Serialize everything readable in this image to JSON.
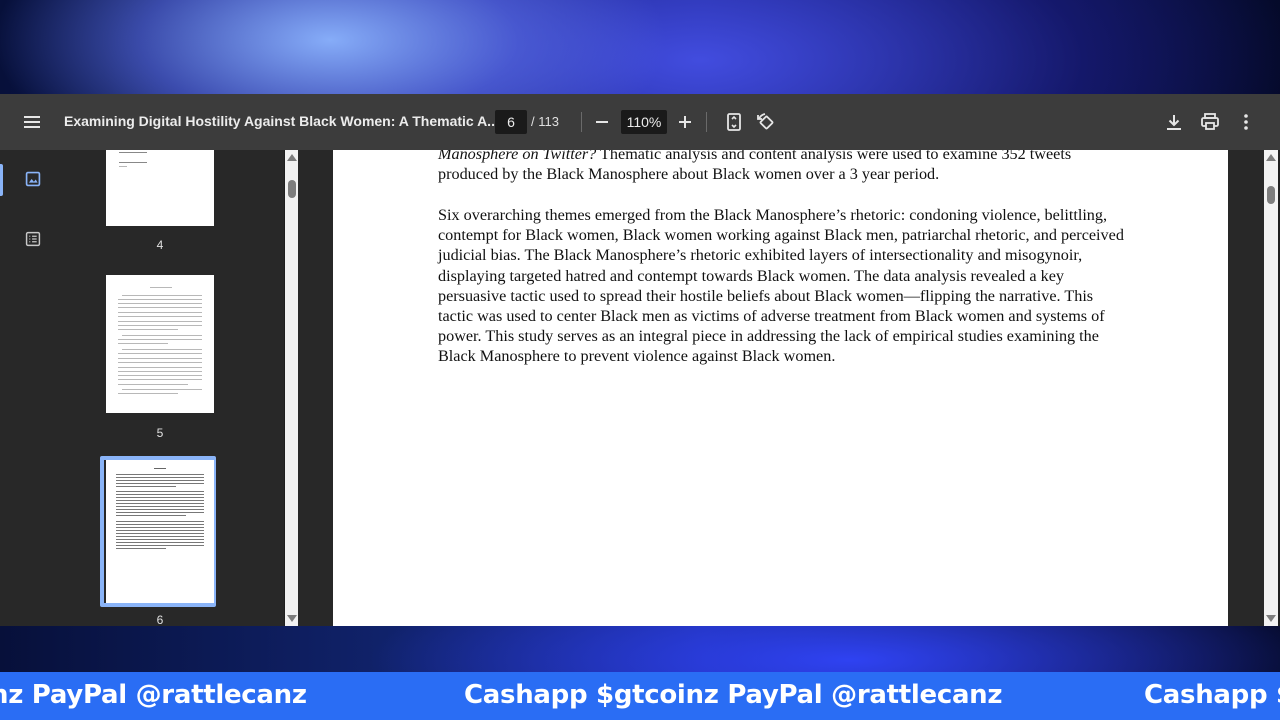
{
  "viewer": {
    "title": "Examining Digital Hostility Against Black Women: A Thematic A...",
    "page_current": "6",
    "page_total": "/ 113",
    "zoom": "110%"
  },
  "thumbnails": [
    {
      "label": "4"
    },
    {
      "label": "5"
    },
    {
      "label": "6",
      "selected": true
    }
  ],
  "page_text": {
    "para1_italic": "Manosphere on Twitter?",
    "para1_rest": " Thematic analysis and content analysis were used to examine 352 tweets produced by the Black Manosphere about Black women over a 3 year period.",
    "para2": "Six overarching themes emerged from the Black Manosphere’s rhetoric: condoning violence, belittling, contempt for Black women, Black women working against Black men, patriarchal rhetoric, and perceived judicial bias. The Black Manosphere’s rhetoric exhibited layers of intersectionality and misogynoir, displaying targeted hatred and contempt towards Black women. The data analysis revealed a key persuasive tactic used to spread their hostile beliefs about Black women—flipping the narrative. This tactic was used to center Black men as victims of adverse treatment from Black women and systems of power. This study serves as an integral piece in addressing the lack of empirical studies examining the Black Manosphere to prevent violence against Black women."
  },
  "banner": {
    "text_left": "nz PayPal @rattlecanz",
    "text_mid": "Cashapp $gtcoinz PayPal @rattlecanz",
    "text_right": "Cashapp $"
  },
  "icons": {
    "menu": "menu-icon",
    "zoom_out": "minus-icon",
    "zoom_in": "plus-icon",
    "fit": "fit-page-icon",
    "rotate": "rotate-icon",
    "download": "download-icon",
    "print": "print-icon",
    "more": "more-vert-icon",
    "thumbnails": "image-icon",
    "outline": "list-icon"
  },
  "colors": {
    "toolbar": "#3c3c3c",
    "accent": "#8ab4f8",
    "banner": "#2a6df4"
  }
}
